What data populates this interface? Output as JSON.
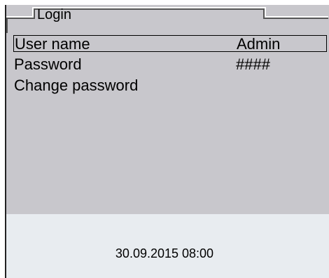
{
  "title": "Login",
  "menu": [
    {
      "label": "User name",
      "value": "Admin",
      "selected": true
    },
    {
      "label": "Password",
      "value": "####",
      "selected": false
    },
    {
      "label": "Change password",
      "value": "",
      "selected": false
    }
  ],
  "status": {
    "datetime": "30.09.2015 08:00"
  },
  "colors": {
    "panel": "#c8c7cc",
    "status_area": "#e8ecf0"
  }
}
